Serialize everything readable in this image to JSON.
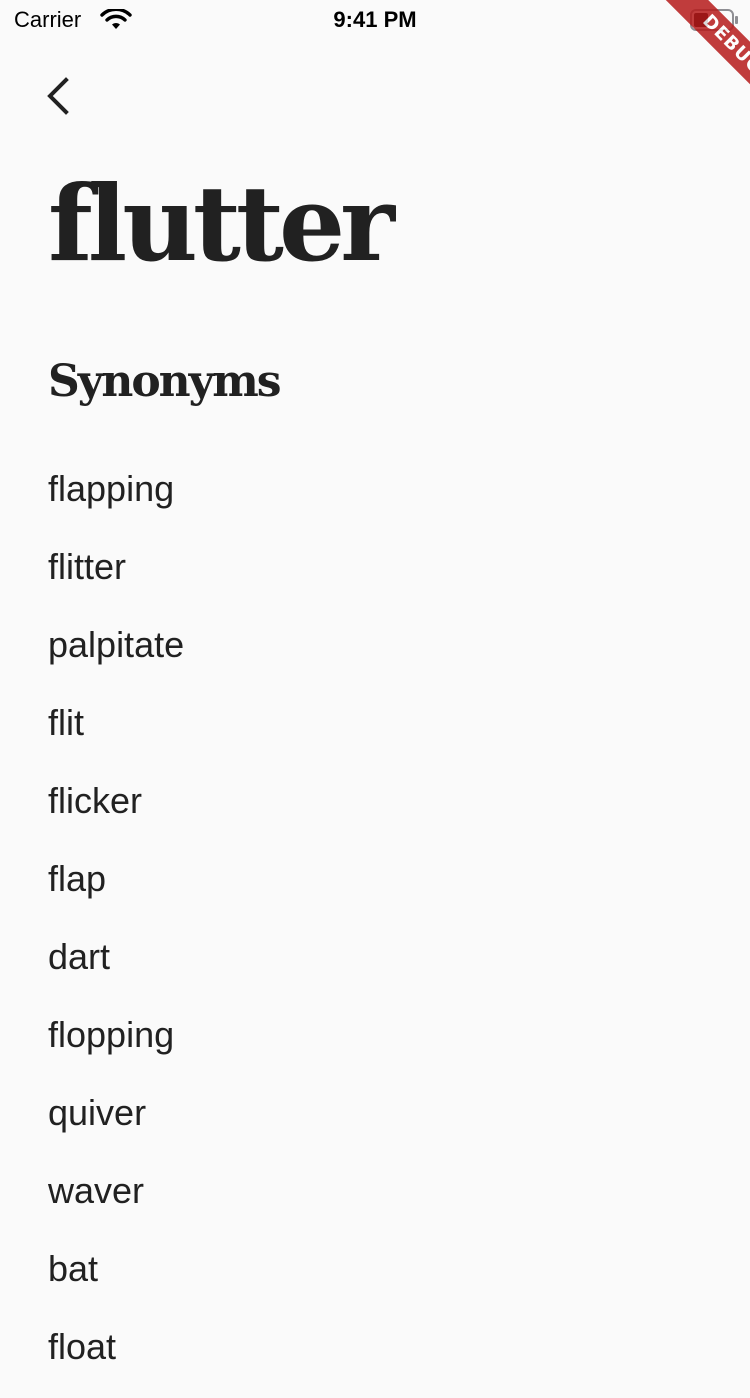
{
  "status_bar": {
    "carrier": "Carrier",
    "time": "9:41 PM",
    "wifi_icon": "wifi-icon",
    "battery_icon": "battery-icon"
  },
  "debug_banner": {
    "label": "DEBUG",
    "color": "#b71c1c"
  },
  "nav": {
    "back_icon": "chevron-left-icon"
  },
  "word": {
    "title": "flutter"
  },
  "synonyms": {
    "heading": "Synonyms",
    "items": [
      "flapping",
      "flitter",
      "palpitate",
      "flit",
      "flicker",
      "flap",
      "dart",
      "flopping",
      "quiver",
      "waver",
      "bat",
      "float"
    ]
  },
  "colors": {
    "background": "#fafafa",
    "text": "#212121"
  }
}
